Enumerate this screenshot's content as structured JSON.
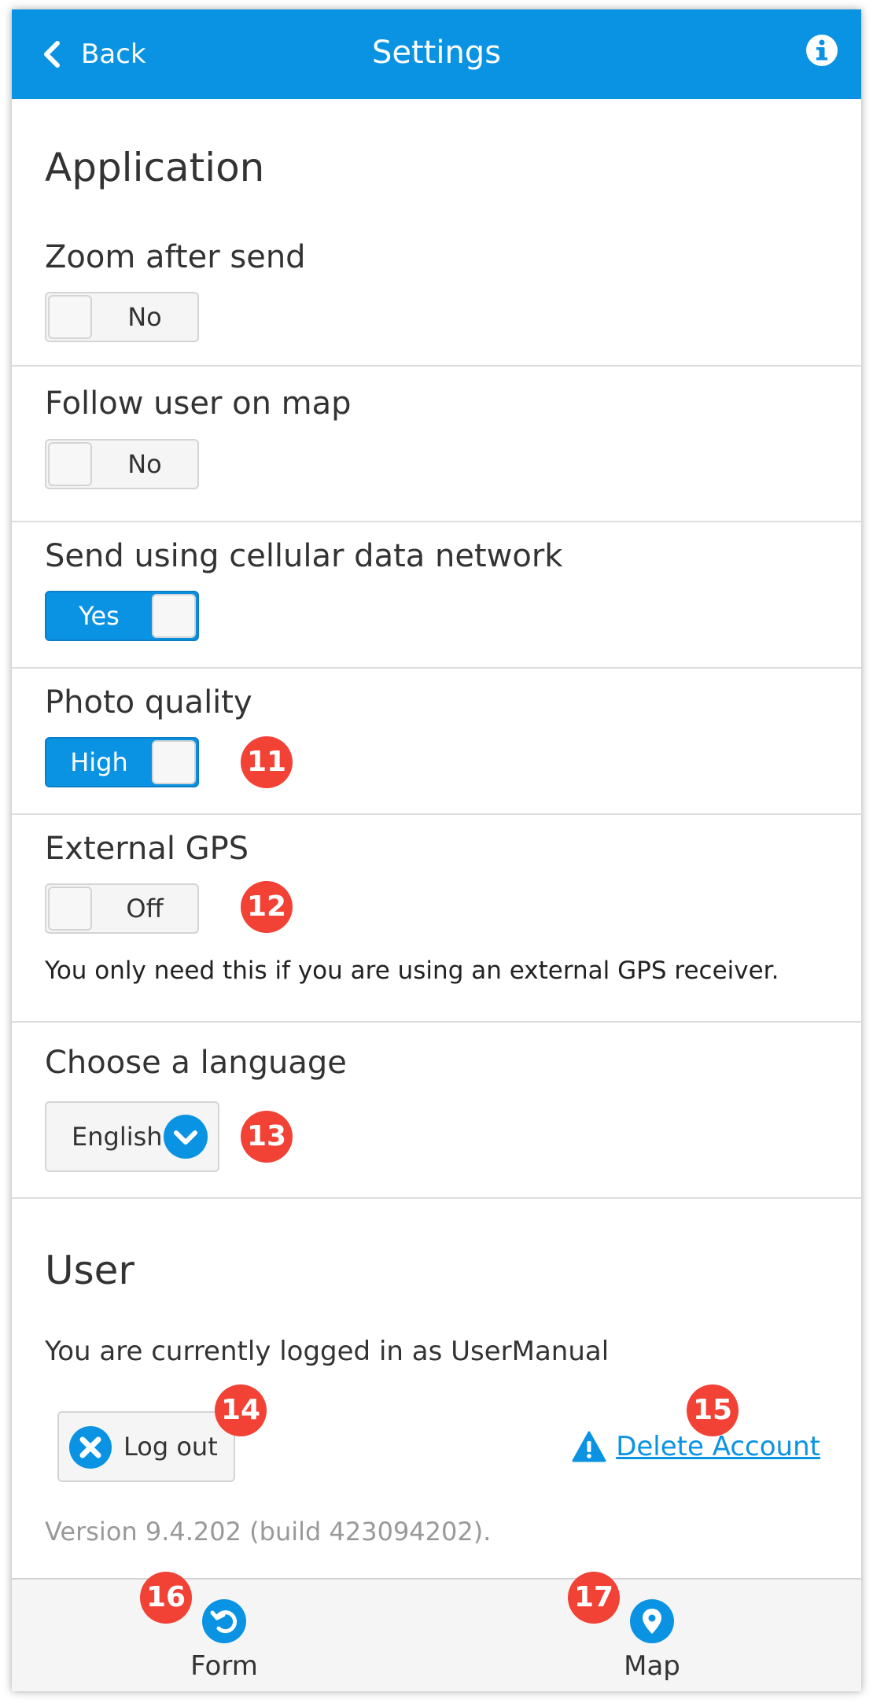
{
  "header": {
    "back_label": "Back",
    "title": "Settings"
  },
  "colors": {
    "accent": "#0a93e3",
    "badge": "#f24236"
  },
  "application": {
    "title": "Application",
    "zoom_after_send": {
      "label": "Zoom after send",
      "value": "No"
    },
    "follow_user": {
      "label": "Follow user on map",
      "value": "No"
    },
    "cellular": {
      "label": "Send using cellular data network",
      "value": "Yes"
    },
    "photo_quality": {
      "label": "Photo quality",
      "value": "High",
      "badge": "11"
    },
    "external_gps": {
      "label": "External GPS",
      "value": "Off",
      "badge": "12",
      "help": "You only need this if you are using an external GPS receiver."
    },
    "language": {
      "label": "Choose a language",
      "value": "English",
      "badge": "13"
    }
  },
  "user": {
    "title": "User",
    "logged_in_text": "You are currently logged in as UserManual",
    "logout_label": "Log out",
    "logout_badge": "14",
    "delete_label": "Delete Account",
    "delete_badge": "15",
    "version": "Version 9.4.202 (build 423094202)."
  },
  "footer": {
    "form_label": "Form",
    "form_badge": "16",
    "map_label": "Map",
    "map_badge": "17"
  },
  "icons": {
    "back": "chevron-left-icon",
    "info": "info-icon",
    "select": "chevron-down-icon",
    "logout": "close-circle-icon",
    "delete": "warning-icon",
    "form": "undo-icon",
    "map": "map-pin-icon"
  }
}
